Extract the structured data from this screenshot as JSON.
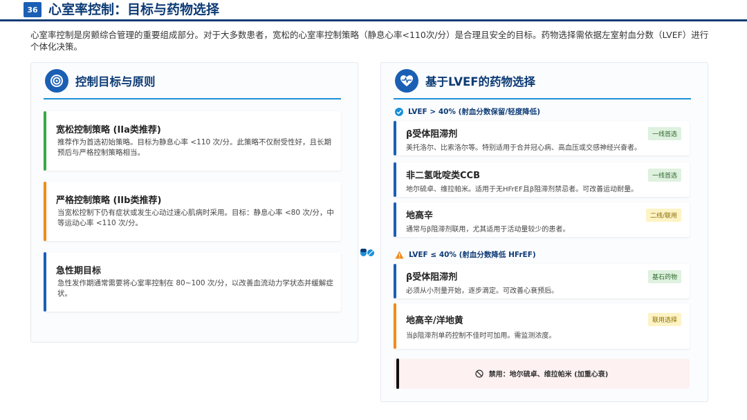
{
  "header": {
    "page_number": "36",
    "title": "心室率控制：目标与药物选择"
  },
  "intro": "心室率控制是房颤综合管理的重要组成部分。对于大多数患者，宽松的心室率控制策略（静息心率<110次/分）是合理且安全的目标。药物选择需依据左室射血分数（LVEF）进行个体化决策。",
  "left_panel": {
    "title": "控制目标与原则",
    "icon": "target-icon",
    "cards": [
      {
        "title": "宽松控制策略 (IIa类推荐)",
        "text": "推荐作为首选初始策略。目标为静息心率 <110 次/分。此策略不仅耐受性好，且长期预后与严格控制策略相当。",
        "color": "#3aa84a"
      },
      {
        "title": "严格控制策略 (IIb类推荐)",
        "text": "当宽松控制下仍有症状或发生心动过速心肌病时采用。目标：静息心率 <80 次/分，中等运动心率 <110 次/分。",
        "color": "#f08c1c"
      },
      {
        "title": "急性期目标",
        "text": "急性发作期通常需要将心室率控制在 80~100 次/分，以改善血流动力学状态并缓解症状。",
        "color": "#1a5fb4"
      }
    ]
  },
  "right_panel": {
    "title": "基于LVEF的药物选择",
    "icon": "heart-pulse-icon",
    "section1_label": "LVEF > 40% (射血分数保留/轻度降低)",
    "section1_cards": [
      {
        "title": "β受体阻滞剂",
        "text": "美托洛尔、比索洛尔等。特别适用于合并冠心病、高血压或交感神经兴奋者。",
        "badge": "一线首选",
        "badge_style": "green",
        "color": "#1a5fb4"
      },
      {
        "title": "非二氢吡啶类CCB",
        "text": "地尔硫卓、维拉帕米。适用于无HFrEF且β阻滞剂禁忌者。可改善运动耐量。",
        "badge": "一线首选",
        "badge_style": "green",
        "color": "#1a5fb4"
      },
      {
        "title": "地高辛",
        "text": "通常与β阻滞剂联用，尤其适用于活动量较少的患者。",
        "badge": "二线/联用",
        "badge_style": "yellow",
        "color": "#1a5fb4"
      }
    ],
    "section2_label": "LVEF ≤ 40% (射血分数降低 HFrEF)",
    "section2_cards": [
      {
        "title": "β受体阻滞剂",
        "text": "必须从小剂量开始，逐步滴定。可改善心衰预后。",
        "badge": "基石药物",
        "badge_style": "green",
        "color": "#1a5fb4"
      },
      {
        "title": "地高辛/洋地黄",
        "text": "当β阻滞剂单药控制不佳时可加用。需监测浓度。",
        "badge": "联用选择",
        "badge_style": "yellow",
        "color": "#f08c1c"
      }
    ],
    "warning": "禁用：地尔硫卓、维拉帕米 (加重心衰)"
  }
}
